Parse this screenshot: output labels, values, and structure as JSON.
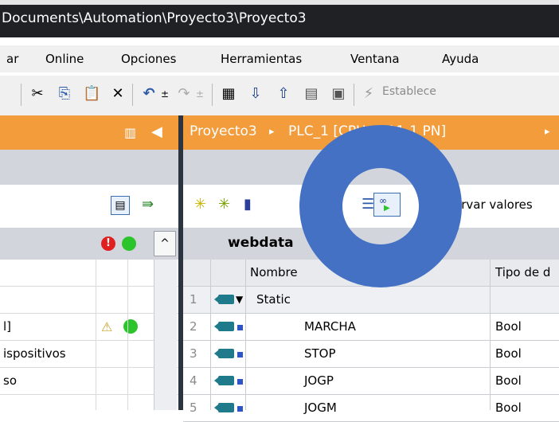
{
  "window": {
    "title": "Documents\\Automation\\Proyecto3\\Proyecto3"
  },
  "menu": [
    "ar",
    "Online",
    "Opciones",
    "Herramientas",
    "Ventana",
    "Ayuda"
  ],
  "toolbar": {
    "establish_label": "Establece"
  },
  "breadcrumb": {
    "project": "Proyecto3",
    "device": "PLC_1 [CPU 1511-1 PN]",
    "sep": "▸"
  },
  "right_toolbar": {
    "observe_label": "ervar valores"
  },
  "block": {
    "title": "webdata"
  },
  "columns": {
    "name": "Nombre",
    "type": "Tipo de d"
  },
  "rows": [
    {
      "num": "1",
      "expand": "▼",
      "name": "Static",
      "type": ""
    },
    {
      "num": "2",
      "name": "MARCHA",
      "type": "Bool"
    },
    {
      "num": "3",
      "name": "STOP",
      "type": "Bool"
    },
    {
      "num": "4",
      "name": "JOGP",
      "type": "Bool"
    },
    {
      "num": "5",
      "name": "JOGM",
      "type": "Bool"
    }
  ],
  "left_tree": {
    "row3": "l]",
    "row4": "ispositivos",
    "row5": "so"
  },
  "colors": {
    "accent_orange": "#f29c3c",
    "highlight_ring": "#4471c4",
    "status_green": "#2bc52b",
    "status_red": "#e02020"
  }
}
